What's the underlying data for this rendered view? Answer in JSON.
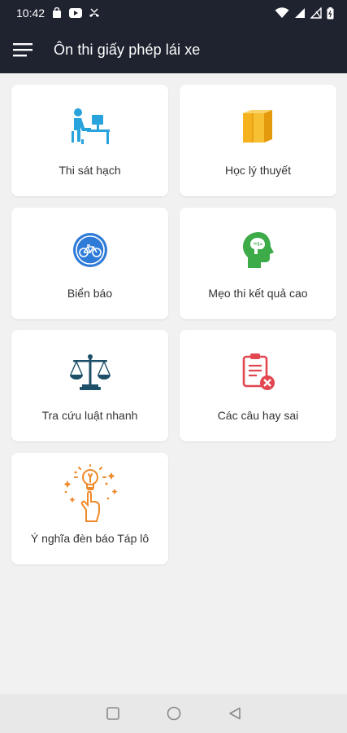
{
  "status": {
    "time": "10:42",
    "left_icons": [
      "bag-icon",
      "youtube-icon",
      "missed-call-icon"
    ],
    "right_icons": [
      "wifi-icon",
      "signal-icon",
      "no-signal-icon",
      "battery-icon"
    ]
  },
  "appbar": {
    "title": "Ôn thi giấy phép lái xe",
    "menu_icon": "hamburger-icon"
  },
  "menu": {
    "items": [
      {
        "label": "Thi sát hạch",
        "icon": "person-at-desk-icon",
        "color": "#29a3dc"
      },
      {
        "label": "Học lý thuyết",
        "icon": "books-icon",
        "color": "#f5b21c"
      },
      {
        "label": "Biển báo",
        "icon": "bicycle-sign-icon",
        "color": "#2f7bd8"
      },
      {
        "label": "Mẹo thi kết quả cao",
        "icon": "head-brain-icon",
        "color": "#3cab48"
      },
      {
        "label": "Tra cứu luật nhanh",
        "icon": "scales-icon",
        "color": "#1d4f68"
      },
      {
        "label": "Các câu hay sai",
        "icon": "clipboard-x-icon",
        "color": "#e2464f"
      },
      {
        "label": "Ý nghĩa đèn báo Táp lô",
        "icon": "idea-bulb-icon",
        "color": "#ef8a2a"
      }
    ]
  },
  "navbar": {
    "icons": [
      "recents-square-icon",
      "home-circle-icon",
      "back-triangle-icon"
    ]
  }
}
